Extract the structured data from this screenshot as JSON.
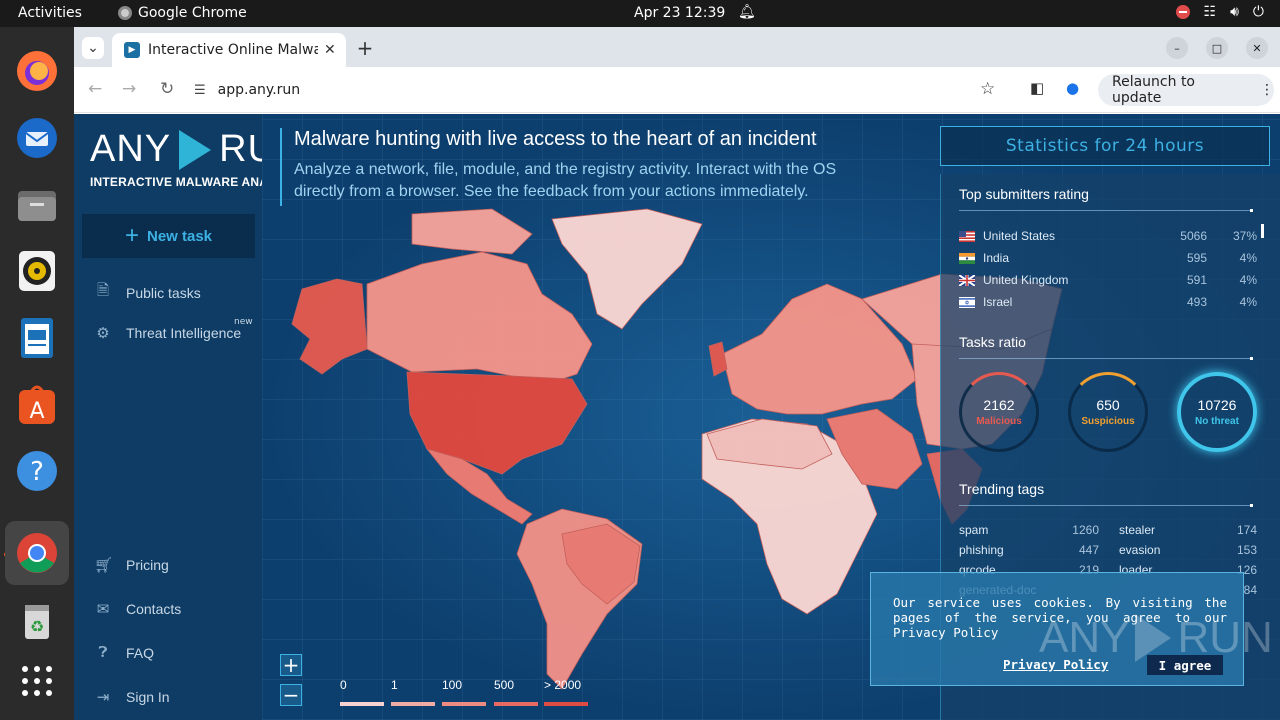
{
  "topbar": {
    "activities": "Activities",
    "app_name": "Google Chrome",
    "clock": "Apr 23  12:39"
  },
  "browser": {
    "tab_title": "Interactive Online Malware",
    "url": "app.any.run",
    "relaunch": "Relaunch to update"
  },
  "sidebar": {
    "logo_left": "ANY",
    "logo_right": "RUN",
    "logo_sub": "INTERACTIVE MALWARE ANALYSIS",
    "new_task": "New task",
    "items": [
      {
        "label": "Public tasks",
        "icon": "document-icon"
      },
      {
        "label": "Threat Intelligence",
        "icon": "gear-icon",
        "badge": "new"
      },
      {
        "label": "Pricing",
        "icon": "cart-icon"
      },
      {
        "label": "Contacts",
        "icon": "mail-icon"
      },
      {
        "label": "FAQ",
        "icon": "help-icon"
      },
      {
        "label": "Sign In",
        "icon": "sign-in-icon"
      }
    ]
  },
  "main": {
    "headline": "Malware hunting with live access to the heart of an incident",
    "subhead": "Analyze a network, file, module, and the registry activity. Interact with the OS directly from a browser. See the feedback from your actions immediately."
  },
  "legend": {
    "labels": [
      "0",
      "1",
      "100",
      "500",
      "> 2000"
    ],
    "colors": [
      "#f6d3d0",
      "#f2aaa4",
      "#ee8a82",
      "#e86a62",
      "#e04b43"
    ]
  },
  "stats": {
    "title": "Statistics for 24 hours",
    "submitters_title": "Top submitters rating",
    "submitters": [
      {
        "country": "United States",
        "count": "5066",
        "pct": "37%"
      },
      {
        "country": "India",
        "count": "595",
        "pct": "4%"
      },
      {
        "country": "United Kingdom",
        "count": "591",
        "pct": "4%"
      },
      {
        "country": "Israel",
        "count": "493",
        "pct": "4%"
      }
    ],
    "ratio_title": "Tasks ratio",
    "ratio": [
      {
        "value": "2162",
        "label": "Malicious",
        "color": "#e85a50"
      },
      {
        "value": "650",
        "label": "Suspicious",
        "color": "#f0a030"
      },
      {
        "value": "10726",
        "label": "No threat",
        "color": "#3fc6ea"
      }
    ],
    "tags_title": "Trending tags",
    "tags": [
      {
        "a": "spam",
        "av": "1260",
        "b": "stealer",
        "bv": "174"
      },
      {
        "a": "phishing",
        "av": "447",
        "b": "evasion",
        "bv": "153"
      },
      {
        "a": "qrcode",
        "av": "219",
        "b": "loader",
        "bv": "126"
      },
      {
        "a": "generated-doc",
        "av": "",
        "b": "",
        "bv": "84"
      }
    ]
  },
  "cookie": {
    "text": "Our service uses cookies. By visiting the pages of the service, you agree to our Privacy Policy",
    "link": "Privacy Policy",
    "agree": "I agree",
    "watermark_left": "ANY",
    "watermark_right": "RUN"
  }
}
